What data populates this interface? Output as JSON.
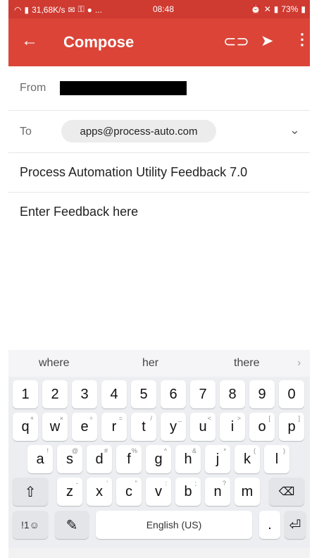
{
  "statusbar": {
    "speed": "31,68K/s",
    "left_icons": [
      "signal-icon",
      "mail-icon",
      "key-icon",
      "vpn-icon"
    ],
    "ellipsis": "...",
    "time": "08:48",
    "battery": "73%"
  },
  "appbar": {
    "title": "Compose"
  },
  "fields": {
    "from_label": "From",
    "to_label": "To",
    "to_chip": "apps@process-auto.com",
    "subject": "Process Automation Utility Feedback 7.0",
    "body_placeholder": "Enter Feedback here"
  },
  "keyboard": {
    "suggestions": [
      "where",
      "her",
      "there"
    ],
    "row_numbers": [
      "1",
      "2",
      "3",
      "4",
      "5",
      "6",
      "7",
      "8",
      "9",
      "0"
    ],
    "row_q": [
      "q",
      "w",
      "e",
      "r",
      "t",
      "y",
      "u",
      "i",
      "o",
      "p"
    ],
    "row_q_hints": [
      "+",
      "×",
      "÷",
      "=",
      "/",
      "_",
      "<",
      ">",
      "[",
      "]"
    ],
    "row_a": [
      "a",
      "s",
      "d",
      "f",
      "g",
      "h",
      "j",
      "k",
      "l"
    ],
    "row_a_hints": [
      "!",
      "@",
      "#",
      "%",
      "^",
      "&",
      "*",
      "(",
      ")"
    ],
    "row_z": [
      "z",
      "x",
      "c",
      "v",
      "b",
      "n",
      "m"
    ],
    "row_z_hints": [
      "-",
      "'",
      "\"",
      ":",
      ";",
      "?",
      ""
    ],
    "bottom": {
      "sym": "!1☺",
      "handwriting": "✎",
      "space": "English (US)",
      "period": "."
    }
  },
  "colors": {
    "appbar": "#db4437",
    "statusbar": "#cf3a31"
  }
}
